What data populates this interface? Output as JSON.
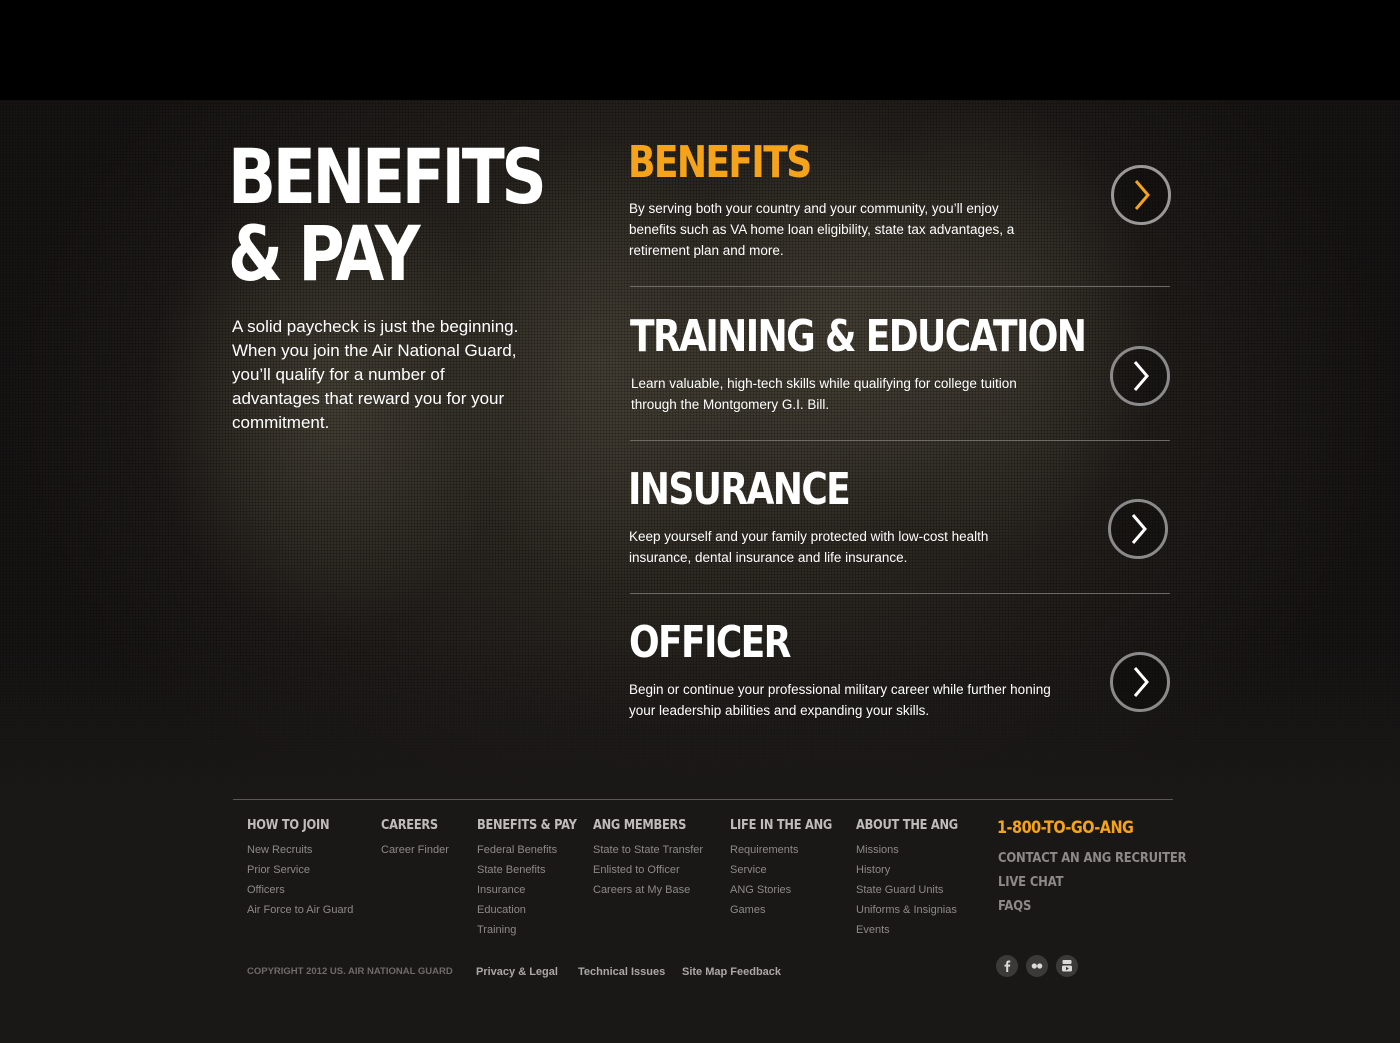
{
  "hero": {
    "title_line1": "BENEFITS",
    "title_line2": "& PAY",
    "intro": "A solid paycheck is just the beginning. When you join the Air National Guard, you’ll qualify for a number of advantages that reward you for your commitment."
  },
  "sections": [
    {
      "title": "BENEFITS",
      "description": "By serving both your country and your community, you’ll enjoy benefits such as VA home loan eligibility, state tax advantages, a retirement plan and more.",
      "title_color": "#f5a31a",
      "arrow_icon": "chevron-right-icon",
      "arrow_color": "#f5a31a"
    },
    {
      "title": "TRAINING & EDUCATION",
      "description": "Learn valuable, high-tech skills while qualifying for college tuition through the Montgomery G.I. Bill.",
      "title_color": "#ffffff",
      "arrow_icon": "chevron-right-icon",
      "arrow_color": "#ffffff"
    },
    {
      "title": "INSURANCE",
      "description": "Keep yourself and your family protected with low-cost health insurance, dental insurance and life insurance.",
      "title_color": "#ffffff",
      "arrow_icon": "chevron-right-icon",
      "arrow_color": "#ffffff"
    },
    {
      "title": "OFFICER",
      "description": "Begin or continue your professional military career while further honing your leadership abilities and expanding your skills.",
      "title_color": "#ffffff",
      "arrow_icon": "chevron-right-icon",
      "arrow_color": "#ffffff"
    }
  ],
  "footer": {
    "columns": [
      {
        "heading": "HOW TO JOIN",
        "links": [
          "New Recruits",
          "Prior Service",
          "Officers",
          "Air Force to Air Guard"
        ]
      },
      {
        "heading": "CAREERS",
        "links": [
          "Career Finder"
        ]
      },
      {
        "heading": "BENEFITS & PAY",
        "links": [
          "Federal Benefits",
          "State Benefits",
          "Insurance",
          "Education",
          "Training"
        ]
      },
      {
        "heading": "ANG MEMBERS",
        "links": [
          "State to State Transfer",
          "Enlisted to Officer",
          "Careers at My Base"
        ]
      },
      {
        "heading": "LIFE IN THE ANG",
        "links": [
          "Requirements",
          "Service",
          "ANG Stories",
          "Games"
        ]
      },
      {
        "heading": "ABOUT THE ANG",
        "links": [
          "Missions",
          "History",
          "State Guard Units",
          "Uniforms & Insignias",
          "Events"
        ]
      }
    ],
    "phone": "1-800-TO-GO-ANG",
    "cta_links": [
      "CONTACT AN ANG RECRUITER",
      "LIVE CHAT",
      "FAQS"
    ],
    "copyright": "COPYRIGHT 2012 US. AIR NATIONAL GUARD",
    "legal_links": [
      "Privacy & Legal",
      "Technical Issues",
      "Site Map Feedback"
    ],
    "social_icons": [
      "facebook-icon",
      "flickr-icon",
      "youtube-icon"
    ]
  },
  "colors": {
    "accent": "#f5a31a",
    "background": "#1a1817",
    "topbar": "#000000"
  }
}
